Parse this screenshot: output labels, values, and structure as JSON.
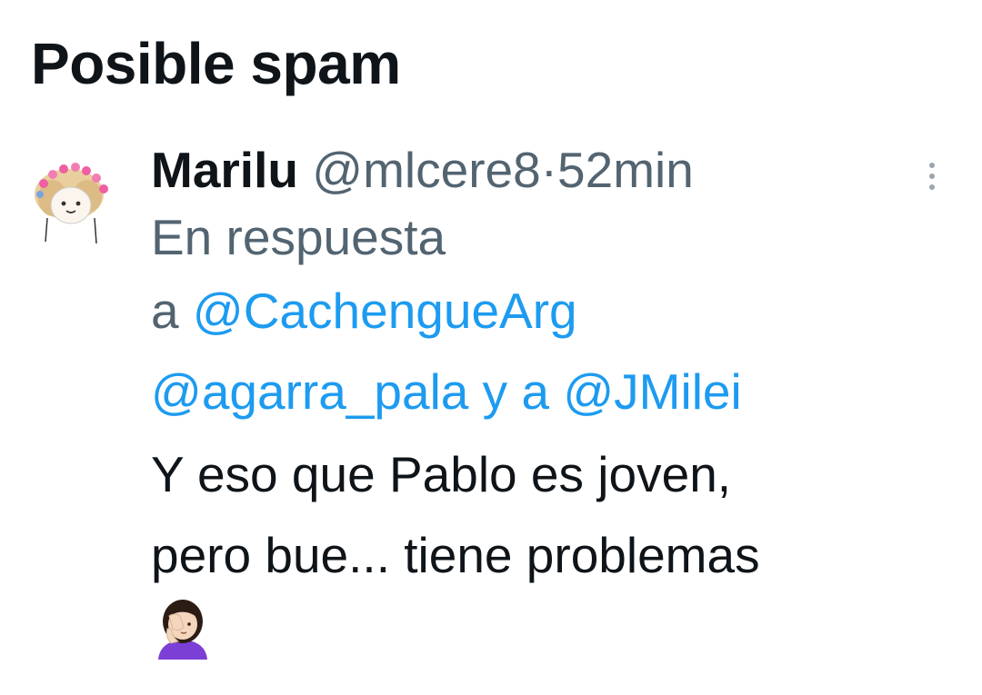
{
  "section": {
    "title": "Posible spam"
  },
  "tweet": {
    "display_name": "Marilu",
    "handle": "@mlcere8",
    "separator": "·",
    "time": "52min",
    "reply_prefix": "En respuesta",
    "reply_a": "a",
    "mentions": [
      "@CachengueArg",
      "@agarra_pala",
      "@JMilei"
    ],
    "reply_and": "y a",
    "text_line_1": "Y eso que Pablo es joven,",
    "text_line_2": "pero bue... tiene problemas",
    "emoji": "woman-facepalming-emoji"
  },
  "colors": {
    "primary_text": "#0f1419",
    "secondary_text": "#536471",
    "link": "#1d9bf0",
    "background": "#ffffff"
  }
}
